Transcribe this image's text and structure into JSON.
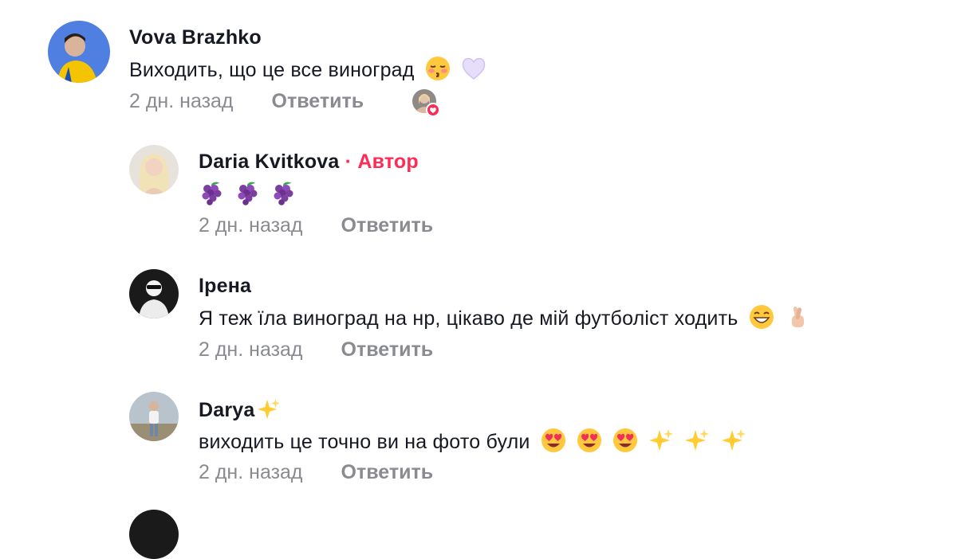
{
  "comments": [
    {
      "author": "Vova Brazhko",
      "text": "Виходить, що це все виноград",
      "emojis": [
        "sleepy-kiss-emoji-icon",
        "white-heart-emoji-icon"
      ],
      "time": "2 дн. назад",
      "reply": "Ответить"
    },
    {
      "author": "Daria  Kvitkova",
      "author_tag": "· Автор",
      "text": "",
      "emojis": [
        "grapes-icon",
        "grapes-icon",
        "grapes-icon"
      ],
      "time": "2 дн. назад",
      "reply": "Ответить"
    },
    {
      "author": "Ірена",
      "text": "Я теж їла виноград на нр, цікаво де мій футболіст ходить",
      "emojis": [
        "grinning-emoji-icon",
        "crossed-fingers-emoji-icon"
      ],
      "time": "2 дн. назад",
      "reply": "Ответить"
    },
    {
      "author": "Darya",
      "author_emoji": "sparkles-icon",
      "text": "виходить це точно ви на фото були",
      "emojis": [
        "heart-eyes-emoji-icon",
        "heart-eyes-emoji-icon",
        "heart-eyes-emoji-icon",
        "sparkles-icon",
        "sparkles-icon",
        "sparkles-icon"
      ],
      "time": "2 дн. назад",
      "reply": "Ответить"
    }
  ],
  "colors": {
    "accent": "#fe2c55",
    "muted": "#8a8b91",
    "text": "#161823"
  }
}
